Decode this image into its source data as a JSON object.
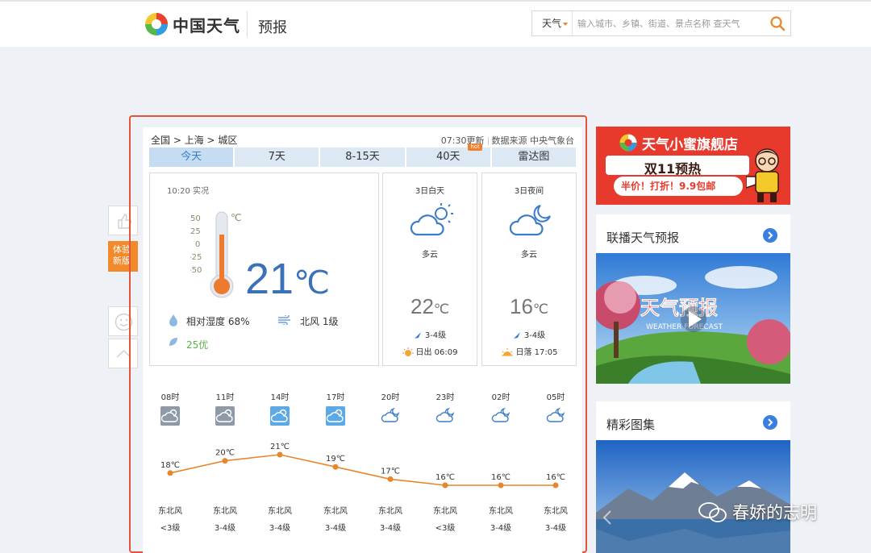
{
  "header": {
    "brand": "中国天气",
    "section": "预报",
    "search_type": "天气",
    "search_placeholder": "输入城市、乡镇、街道、景点名称 查天气"
  },
  "side_tools": {
    "promo_label": "体验新版"
  },
  "breadcrumb": {
    "path": "全国 > 上海 > 城区",
    "updated": "07:30更新",
    "source": "数据来源 中央气象台"
  },
  "tabs": [
    {
      "label": "今天",
      "active": true
    },
    {
      "label": "7天"
    },
    {
      "label": "8-15天"
    },
    {
      "label": "40天",
      "badge": "hot"
    },
    {
      "label": "雷达图"
    }
  ],
  "current": {
    "time": "10:20 实况",
    "temp": "21",
    "unit": "℃",
    "thermo_scale": [
      "50",
      "25",
      "0",
      "-25",
      "-50"
    ],
    "thermo_unit": "℃",
    "humidity": "相对湿度  68%",
    "wind": "北风  1级",
    "aqi": "25优"
  },
  "day": {
    "title": "3日白天",
    "desc": "多云",
    "temp": "22",
    "unit": "℃",
    "wind": "3-4级",
    "sun": "日出 06:09"
  },
  "night": {
    "title": "3日夜间",
    "desc": "多云",
    "temp": "16",
    "unit": "℃",
    "wind": "3-4级",
    "sun": "日落 17:05"
  },
  "hourly": {
    "hours": [
      "08时",
      "11时",
      "14时",
      "17时",
      "20时",
      "23时",
      "02时",
      "05时"
    ],
    "temps": [
      18,
      20,
      21,
      19,
      17,
      16,
      16,
      16
    ],
    "temp_labels": [
      "18℃",
      "20℃",
      "21℃",
      "19℃",
      "17℃",
      "16℃",
      "16℃",
      "16℃"
    ],
    "wind_dir": [
      "东北风",
      "东北风",
      "东北风",
      "东北风",
      "东北风",
      "东北风",
      "东北风",
      "东北风"
    ],
    "wind_level": [
      "<3级",
      "3-4级",
      "3-4级",
      "3-4级",
      "3-4级",
      "<3级",
      "3-4级",
      "3-4级"
    ],
    "icons": [
      "cloudy-day-icon",
      "cloudy-day-icon",
      "partly-cloudy-day-icon",
      "partly-cloudy-day-icon",
      "cloudy-night-icon",
      "cloudy-night-icon",
      "cloudy-night-icon",
      "cloudy-night-icon"
    ],
    "line_color": "#e8862d"
  },
  "right": {
    "ad_title": "天气小蜜旗舰店",
    "ad_sub": "双11预热",
    "ad_tag": "半价！打折！9.9包邮",
    "card1_title": "联播天气预报",
    "card1_image_text": "天气预报",
    "card1_image_sub": "WEATHER FORECAST",
    "card2_title": "精彩图集"
  },
  "watermark": "春娇的志明",
  "colors": {
    "accent": "#3a7fdf",
    "frame": "#e4543a",
    "tab_active": "#c6dcf2",
    "tab": "#dde8f5",
    "aqi_good": "#5bb544",
    "brand_orange": "#f28a2c"
  }
}
